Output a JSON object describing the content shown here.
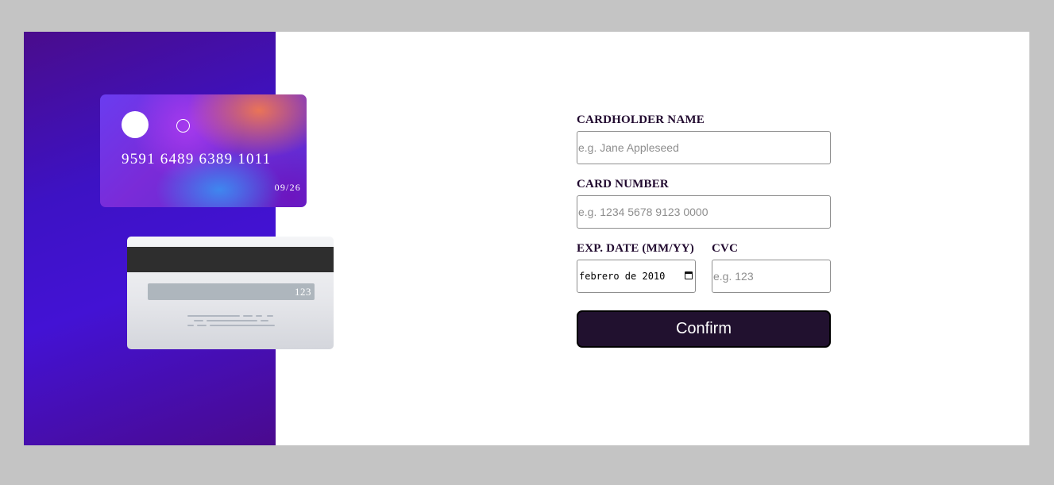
{
  "card_front": {
    "number": "9591 6489 6389 1011",
    "expiry": "09/26"
  },
  "card_back": {
    "cvc": "123"
  },
  "form": {
    "cardholder": {
      "label": "CARDHOLDER NAME",
      "placeholder": "e.g. Jane Appleseed",
      "value": ""
    },
    "number": {
      "label": "CARD NUMBER",
      "placeholder": "e.g. 1234 5678 9123 0000",
      "value": ""
    },
    "expiry": {
      "label": "EXP. DATE (MM/YY)",
      "value": "febrero de 2010",
      "icon": "calendar-icon"
    },
    "cvc": {
      "label": "CVC",
      "placeholder": "e.g. 123",
      "value": ""
    },
    "confirm_label": "Confirm"
  },
  "colors": {
    "page_background": "#c4c4c4",
    "sidebar_start": "#4a0c8c",
    "sidebar_mid": "#4312d4",
    "label_text": "#21092f",
    "button_background": "#21112f",
    "button_text": "#ffffff"
  }
}
